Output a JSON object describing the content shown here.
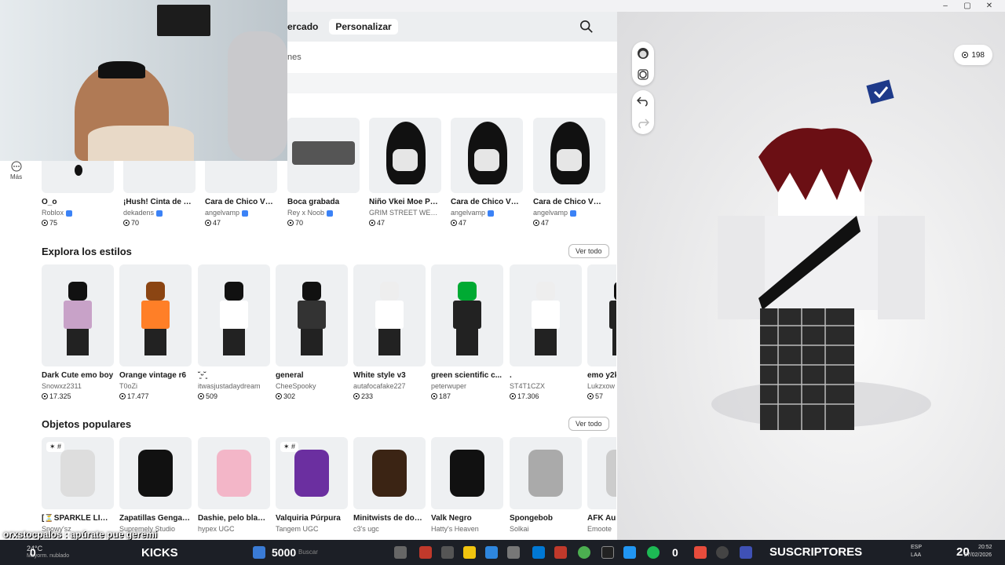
{
  "window": {
    "minimize": "–",
    "maximize": "▢",
    "close": "✕"
  },
  "nav": {
    "tab_market": "ercado",
    "tab_customize": "Personalizar",
    "sub_label": "nes"
  },
  "sidebar": {
    "more_label": "Más"
  },
  "row1": [
    {
      "name": "O_o",
      "creator": "Roblox",
      "price": "75",
      "verified": true
    },
    {
      "name": "¡Hush! Cinta de con...",
      "creator": "dekadens",
      "price": "70",
      "verified": true
    },
    {
      "name": "Cara de Chico Vkei ...",
      "creator": "angelvamp",
      "price": "47",
      "verified": true
    },
    {
      "name": "Boca grabada",
      "creator": "Rey x Noob",
      "price": "70",
      "verified": true
    },
    {
      "name": "Niño Vkei Moe Pelo",
      "creator": "GRIM STREET WEAR...",
      "price": "47",
      "verified": false
    },
    {
      "name": "Cara de Chico Vkei ...",
      "creator": "angelvamp",
      "price": "47",
      "verified": true
    },
    {
      "name": "Cara de Chico Vkei ...",
      "creator": "angelvamp",
      "price": "47",
      "verified": true
    }
  ],
  "styles_section": {
    "title": "Explora los estilos",
    "see_all": "Ver todo"
  },
  "styles": [
    {
      "name": "Dark Cute emo boy",
      "creator": "Snowxz2311",
      "price": "17.325"
    },
    {
      "name": "Orange vintage r6",
      "creator": "T0oZi",
      "price": "17.477"
    },
    {
      "name": "˘͈ᵕ˘͈",
      "creator": "itwasjustadaydream",
      "price": "509"
    },
    {
      "name": "general",
      "creator": "CheeSpooky",
      "price": "302"
    },
    {
      "name": "White style v3",
      "creator": "autafocafake227",
      "price": "233"
    },
    {
      "name": "green scientific c...",
      "creator": "peterwuper",
      "price": "187"
    },
    {
      "name": ".",
      "creator": "ST4T1CZX",
      "price": "17.306"
    },
    {
      "name": "emo y2k",
      "creator": "Lukzxow",
      "price": "57"
    }
  ],
  "popular_section": {
    "title": "Objetos populares",
    "see_all": "Ver todo"
  },
  "popular": [
    {
      "name": "[⏳SPARKLE LIMIT...",
      "creator": "Snowy'sz",
      "badge": "✶ #"
    },
    {
      "name": "Zapatillas Gengar ...",
      "creator": "Supremely Studio",
      "badge": ""
    },
    {
      "name": "Dashie, pelo blanc...",
      "creator": "hypex UGC",
      "badge": ""
    },
    {
      "name": "Valquiria Púrpura",
      "creator": "Tangem UGC",
      "badge": "✶ #"
    },
    {
      "name": "Minitwists de dos ...",
      "creator": "c3's ugc",
      "badge": ""
    },
    {
      "name": "Valk Negro",
      "creator": "Hatty's Heaven",
      "badge": ""
    },
    {
      "name": "Spongebob",
      "creator": "Solkai",
      "badge": ""
    },
    {
      "name": "AFK Aura",
      "creator": "Emoote",
      "badge": ""
    }
  ],
  "avatar": {
    "robux": "198"
  },
  "overlay": {
    "chat": "orxstocpalos : apúrate pue geremi"
  },
  "taskbar": {
    "weather_temp": "24°C",
    "weather_text": "Mayorm. nublado",
    "counter_left": "0",
    "kicks_label": "KICKS",
    "count_5000": "5000",
    "search_placeholder": "Buscar",
    "counter_mid": "0",
    "subs_label": "SUSCRIPTORES",
    "lang_top": "ESP",
    "lang_bottom": "LAA",
    "subs_count": "20",
    "time": "20:52",
    "date": "27/02/2026"
  },
  "colors": {
    "accent_blue": "#3b82f6",
    "taskbar": "#1c1f26"
  }
}
